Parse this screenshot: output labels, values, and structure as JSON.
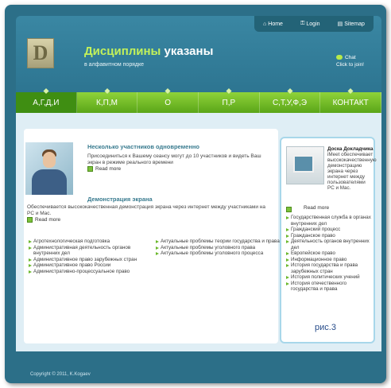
{
  "topbar": {
    "home": "Home",
    "login": "Login",
    "sitemap": "Sitemap"
  },
  "header": {
    "title_part1": "Дисциплины",
    "title_part2": "указаны",
    "subtitle": "в алфавитном порядке",
    "chat_title": "Chat",
    "chat_sub": "Click to join!"
  },
  "nav": {
    "items": [
      "А,Г,Д,И",
      "К,П,М",
      "О",
      "П,Р",
      "С,Т,У,Ф,Э",
      "КОНТАКТ"
    ]
  },
  "main": {
    "block1_title": "Несколько участников одновременно",
    "block1_text": "Присоединиться к Вашему сеансу могут до 10 участников и видеть Ваш экран в режиме реального времени",
    "read_more": "Read more",
    "block2_title": "Демонстрация экрана",
    "block2_text": "Обеспечивается высококачественная демонстрация экрана через интернет между участниками на PC и Mac.",
    "links_col1": [
      "Агротехнологическая подготовка",
      "Административная деятельность органов внутренних дел",
      "Административное право зарубежных стран",
      "Административное право России",
      "Административно-процессуальное право"
    ],
    "links_col2": [
      "Актуальные проблемы теории государства и права",
      "Актуальные проблемы уголовного права",
      "Актуальные проблемы уголовного процесса"
    ]
  },
  "sidebar": {
    "title": "Доска Докладчика",
    "text": "iMeet обеспечивает высококачественную демонстрацию экрана через интернет между пользователями PC и Mac.",
    "read_more": "Read more",
    "list": [
      "Государственная служба в органах внутренних дел",
      "Гражданский процесс",
      "Гражданское право",
      "Деятельность органов внутренних дел",
      "Европейское право",
      "Информационное право",
      "История государства и права зарубежных стран",
      "История политических учений",
      "История отечественного государства и права"
    ],
    "caption": "рис.3"
  },
  "footer": {
    "copyright": "Copyright © 2011, K.Kogaev"
  },
  "colors": {
    "frame": "#2c6f88",
    "nav": "#6bb82b",
    "accent": "#c3f15a"
  }
}
